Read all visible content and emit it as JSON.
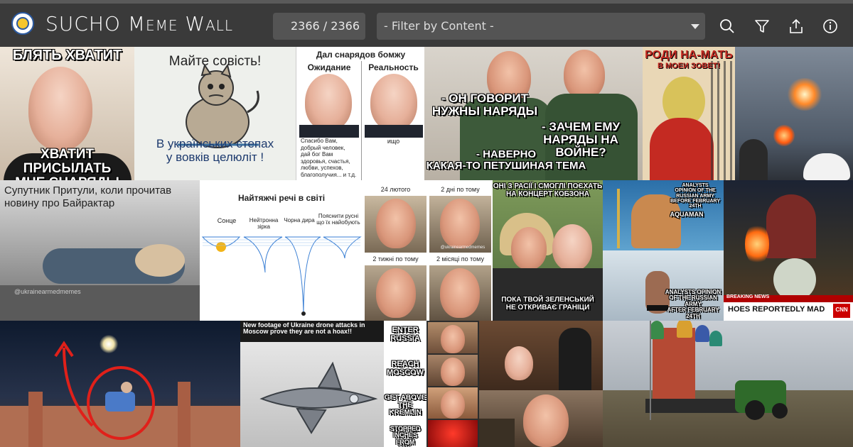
{
  "header": {
    "title_prefix": "SUCHO",
    "title_suffix": "Meme Wall",
    "counter": "2366 / 2366",
    "filter_placeholder": "- Filter by Content -",
    "icons": [
      "search-icon",
      "filter-icon",
      "share-icon",
      "info-icon"
    ],
    "colors": {
      "bar": "#3a3a3a",
      "field": "#545454",
      "text": "#ffffff"
    }
  },
  "tiles": {
    "t1": {
      "top_caption": "БЛЯТЬ ХВАТИТ",
      "bottom_caption": "ХВАТИТ ПРИСЫЛАТЬ\nМНЕ СНАРЯДЫ"
    },
    "t2": {
      "top_caption": "Майте совість!",
      "bottom_caption": "В українських степах\nу вовків целюліт !"
    },
    "t3": {
      "title": "Дал снарядов бомжу",
      "left_label": "Ожидание",
      "right_label": "Реальность",
      "left_text": "Спасибо Вам,\nдобрый человек,\nдай бог Вам\nздоровья, счастья,\nлюбви, успехов,\nблагополучия... и т.д.",
      "right_text": "ищо"
    },
    "t4": {
      "caption_1": "- ОН ГОВОРИТ\nНУЖНЫ НАРЯДЫ",
      "caption_2": "- ЗАЧЕМ ЕМУ\nНАРЯДЫ НА ВОЙНЕ?",
      "caption_3": "- НАВЕРНО\nКАКАЯ-ТО ПЕТУШИНАЯ ТЕМА"
    },
    "t5": {
      "caption_top": "РОДИ НА-МАТЬ",
      "caption_mid": "В МОЕИ ЗОВЕТ!"
    },
    "t6": {},
    "t7": {
      "caption": "Супутник Притули, коли прочитав\nновину про Байрактар",
      "watermark": "@ukrainearmedmemes"
    },
    "t8": {
      "title": "Найтяжчі речі в світі",
      "labels": [
        "Сонце",
        "Нейтронна зірка",
        "Чорна дира",
        "Пояснити русні\nщо їх найобують"
      ]
    },
    "t9": {
      "labels": [
        "24 лютого",
        "2 дні по тому",
        "2 тижні по тому",
        "2 місяці по тому"
      ],
      "watermark": "@ukrainearmedmemes"
    },
    "t10": {
      "top_caption": "ОНІ З РАСІЇ І СМОГЛІ ПОЄХАТЬ\nНА КОНЦЕРТ КОБЗОНА",
      "bottom_caption": "ПОКА ТВОЙ ЗЕЛЕНСЬКИЙ\nНЕ ОТКРИВАЄ ГРАНІЦИ"
    },
    "t11": {
      "top_caption": "ANALYSTS\nOPINION OF THE\nRUSSIAN ARMY\nBEFORE FEBRUARY 24TH",
      "bottom_caption": "ANALYSTS OPINION\nOF THE RUSSIAN ARMY\nAFTER FEBRUARY 24TH",
      "poster_text": "AQUAMAN"
    },
    "t12": {
      "breaking": "BREAKING NEWS",
      "headline": "HOES REPORTEDLY MAD",
      "network": "CNN"
    },
    "t13": {},
    "t14": {
      "caption": "New footage of Ukraine drone attacks in\nMoscow prove they are not a hoax!!"
    },
    "t15": {
      "steps": [
        "ENTER\nRUSSIA",
        "REACH\nMOSCOW",
        "GET ABOVE\nTHE KREMLIN",
        "STOPPED\nINCHES FROM\nTHE KREMLIN"
      ]
    },
    "t16": {},
    "t17": {},
    "t18": {},
    "t19": {}
  }
}
